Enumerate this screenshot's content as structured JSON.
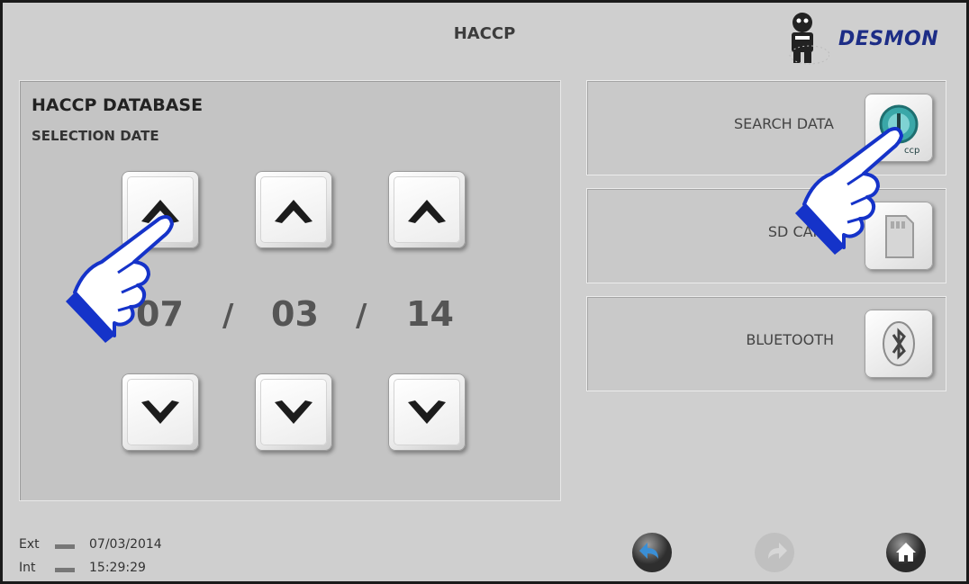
{
  "header": {
    "title": "HACCP",
    "brand": "DESMON"
  },
  "panel": {
    "title": "HACCP DATABASE",
    "subtitle": "SELECTION DATE",
    "date": {
      "day": "07",
      "month": "03",
      "year": "14",
      "separator": "/"
    }
  },
  "options": [
    {
      "label": "SEARCH DATA",
      "icon": "haccp-icon"
    },
    {
      "label": "SD CARD",
      "icon": "sd-card-icon"
    },
    {
      "label": "BLUETOOTH",
      "icon": "bluetooth-icon"
    }
  ],
  "status": {
    "ext_label": "Ext",
    "ext_value": "07/03/2014",
    "int_label": "Int",
    "int_value": "15:29:29"
  },
  "colors": {
    "brand": "#1d2d86",
    "hand_outline": "#1533c9",
    "panel": "#c4c4c4"
  }
}
